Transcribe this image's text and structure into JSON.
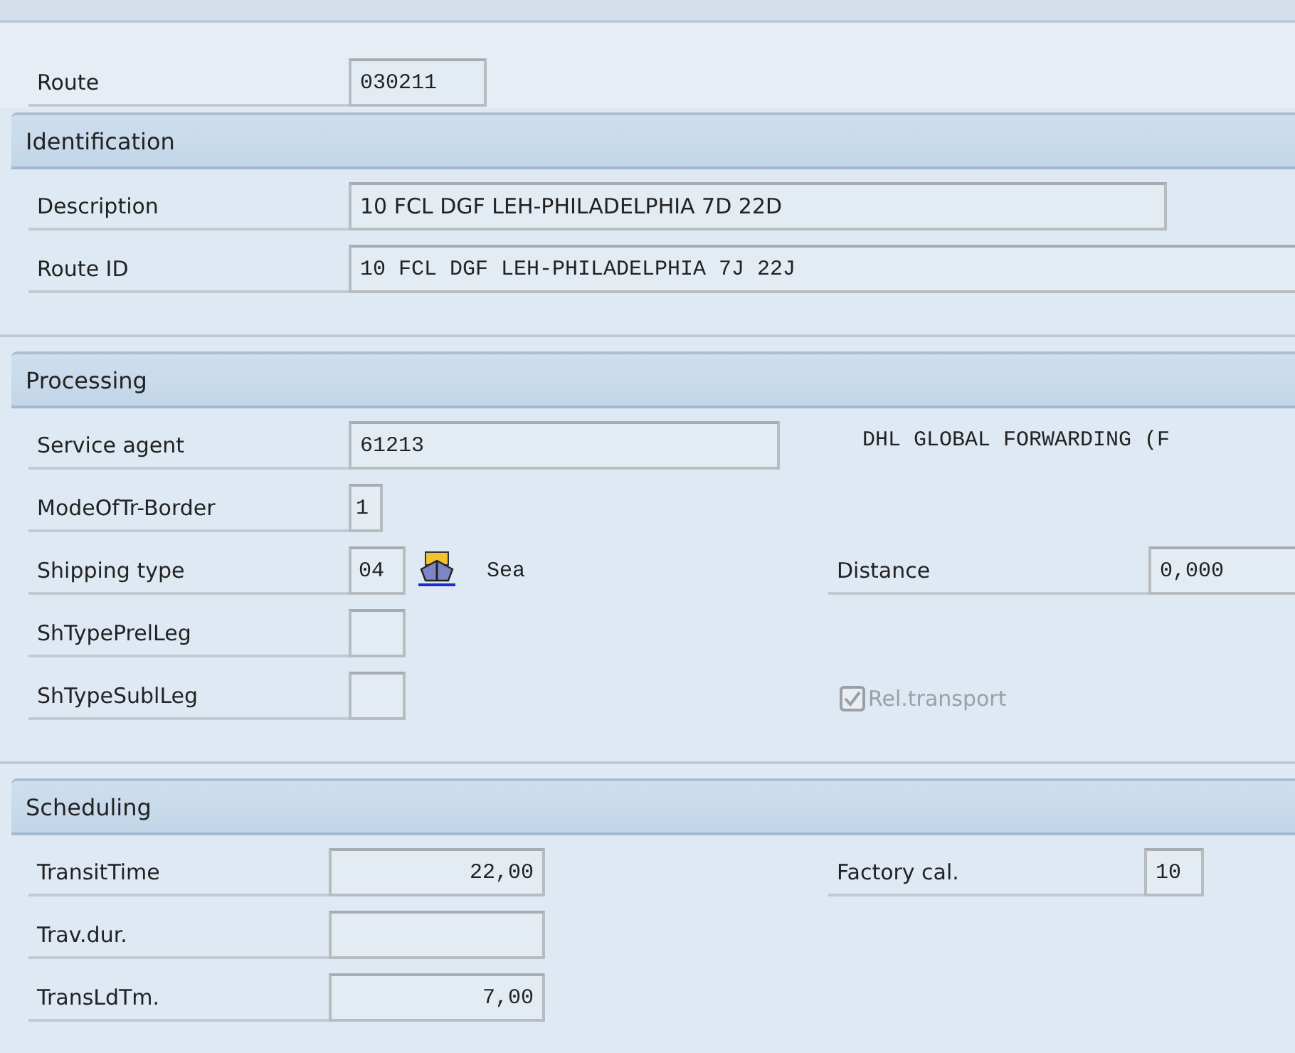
{
  "route": {
    "label": "Route",
    "value": "030211"
  },
  "identification": {
    "title": "Identification",
    "description": {
      "label": "Description",
      "value": "10 FCL DGF LEH-PHILADELPHIA 7D 22D"
    },
    "route_id": {
      "label": "Route ID",
      "value": "10 FCL DGF LEH-PHILADELPHIA 7J 22J"
    }
  },
  "processing": {
    "title": "Processing",
    "service_agent": {
      "label": "Service agent",
      "value": "61213",
      "name": "DHL GLOBAL FORWARDING (F"
    },
    "mode_of_transport_border": {
      "label": "ModeOfTr-Border",
      "value": "1"
    },
    "shipping_type": {
      "label": "Shipping type",
      "value": "04",
      "text": "Sea"
    },
    "distance": {
      "label": "Distance",
      "value": "0,000"
    },
    "sh_type_prel_leg": {
      "label": "ShTypePrelLeg"
    },
    "sh_type_subl_leg": {
      "label": "ShTypeSublLeg"
    },
    "rel_transport": {
      "label": "Rel.transport",
      "checked": true,
      "disabled": true
    }
  },
  "scheduling": {
    "title": "Scheduling",
    "transit_time": {
      "label": "TransitTime",
      "value": "22,00"
    },
    "factory_calendar": {
      "label": "Factory cal.",
      "value": "10"
    },
    "trav_dur": {
      "label": "Trav.dur."
    },
    "trans_ld_tm": {
      "label": "TransLdTm.",
      "value": "7,00"
    }
  }
}
